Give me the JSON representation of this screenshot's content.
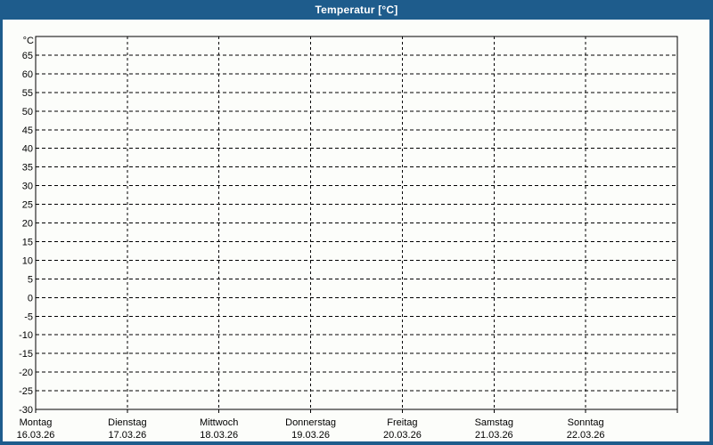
{
  "window": {
    "title": "Temperatur [°C]"
  },
  "colors": {
    "frame_blue": "#1e5c8c",
    "background": "#fcfdfa",
    "grid": "#000000",
    "title_text": "#ffffff"
  },
  "chart_data": {
    "type": "line",
    "title": "Temperatur [°C]",
    "ylabel": "°C",
    "xlabel": "",
    "ylim": [
      -30,
      70
    ],
    "ytick_step": 5,
    "ytick_labels": [
      65,
      60,
      55,
      50,
      45,
      40,
      35,
      30,
      25,
      20,
      15,
      10,
      5,
      0,
      -5,
      -10,
      -15,
      -20,
      -25,
      -30
    ],
    "categories": [
      {
        "day": "Montag",
        "date": "16.03.26"
      },
      {
        "day": "Dienstag",
        "date": "17.03.26"
      },
      {
        "day": "Mittwoch",
        "date": "18.03.26"
      },
      {
        "day": "Donnerstag",
        "date": "19.03.26"
      },
      {
        "day": "Freitag",
        "date": "20.03.26"
      },
      {
        "day": "Samstag",
        "date": "21.03.26"
      },
      {
        "day": "Sonntag",
        "date": "22.03.26"
      }
    ],
    "series": [],
    "grid": "dashed",
    "legend": "none"
  }
}
